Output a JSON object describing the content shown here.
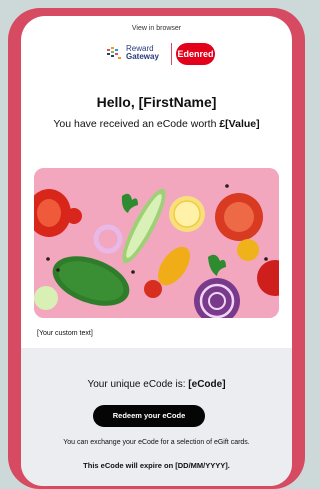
{
  "email": {
    "view_in_browser": "View in browser",
    "greeting": "Hello, [FirstName]",
    "received_prefix": "You have received an eCode worth ",
    "received_value": "£[Value]",
    "custom_text": "[Your custom text]",
    "code_prefix": "Your unique eCode is: ",
    "code_value": "[eCode]",
    "redeem_button": "Redeem your eCode",
    "exchange_text": "You can exchange your eCode for a selection of eGift cards.",
    "expiry_text": "This eCode will expire on [DD/MM/YYYY]."
  },
  "logos": {
    "reward_gateway_line1": "Reward",
    "reward_gateway_line2": "Gateway",
    "edenred": "Edenred"
  },
  "colors": {
    "frame": "#d64a62",
    "page_background": "#cdd8d8",
    "button": "#050505",
    "panel": "#ebedf0",
    "hero_background": "#f2a7bf"
  },
  "icons": {
    "reward_gateway_logo": "reward-gateway-logo-icon",
    "edenred_logo": "edenred-logo-icon",
    "hero_image": "vegetables-photo"
  }
}
